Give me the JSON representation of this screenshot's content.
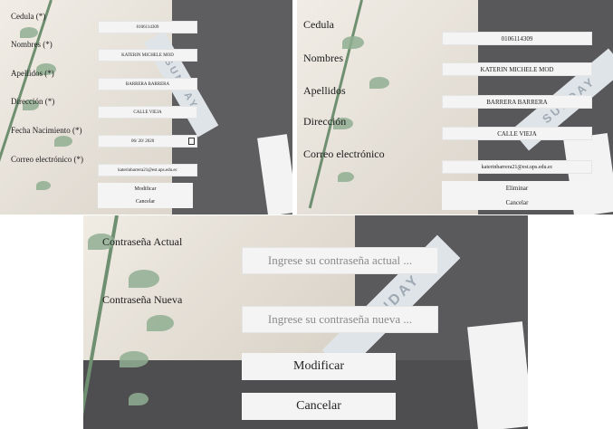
{
  "ribbon_text": "SUNDAY",
  "form1": {
    "labels": {
      "cedula": "Cedula (*)",
      "nombres": "Nombres (*)",
      "apellidos": "Apellidos (*)",
      "direccion": "Dirección (*)",
      "fecha_nacimiento": "Fecha Nacimiento (*)",
      "correo": "Correo electrónico (*)"
    },
    "values": {
      "cedula": "0106114309",
      "nombres": "KATERIN MICHELE MOD",
      "apellidos": "BARRERA BARRERA",
      "direccion": "CALLE VIEJA",
      "fecha_nacimiento": "06/ 20/ 2020",
      "correo": "katerinbarrera21@est.ups.edu.ec"
    },
    "buttons": {
      "modificar": "Modificar",
      "cancelar": "Cancelar"
    }
  },
  "form2": {
    "labels": {
      "cedula": "Cedula",
      "nombres": "Nombres",
      "apellidos": "Apellidos",
      "direccion": "Dirección",
      "correo": "Correo electrónico"
    },
    "values": {
      "cedula": "0106114309",
      "nombres": "KATERIN MICHELE MOD",
      "apellidos": "BARRERA BARRERA",
      "direccion": "CALLE VIEJA",
      "correo": "katerinbarrera21@est.ups.edu.ec"
    },
    "buttons": {
      "eliminar": "Eliminar",
      "cancelar": "Cancelar"
    }
  },
  "form3": {
    "labels": {
      "actual": "Contraseña Actual",
      "nueva": "Contraseña Nueva"
    },
    "placeholders": {
      "actual": "Ingrese su contraseña actual ...",
      "nueva": "Ingrese su contraseña nueva ..."
    },
    "buttons": {
      "modificar": "Modificar",
      "cancelar": "Cancelar"
    }
  }
}
